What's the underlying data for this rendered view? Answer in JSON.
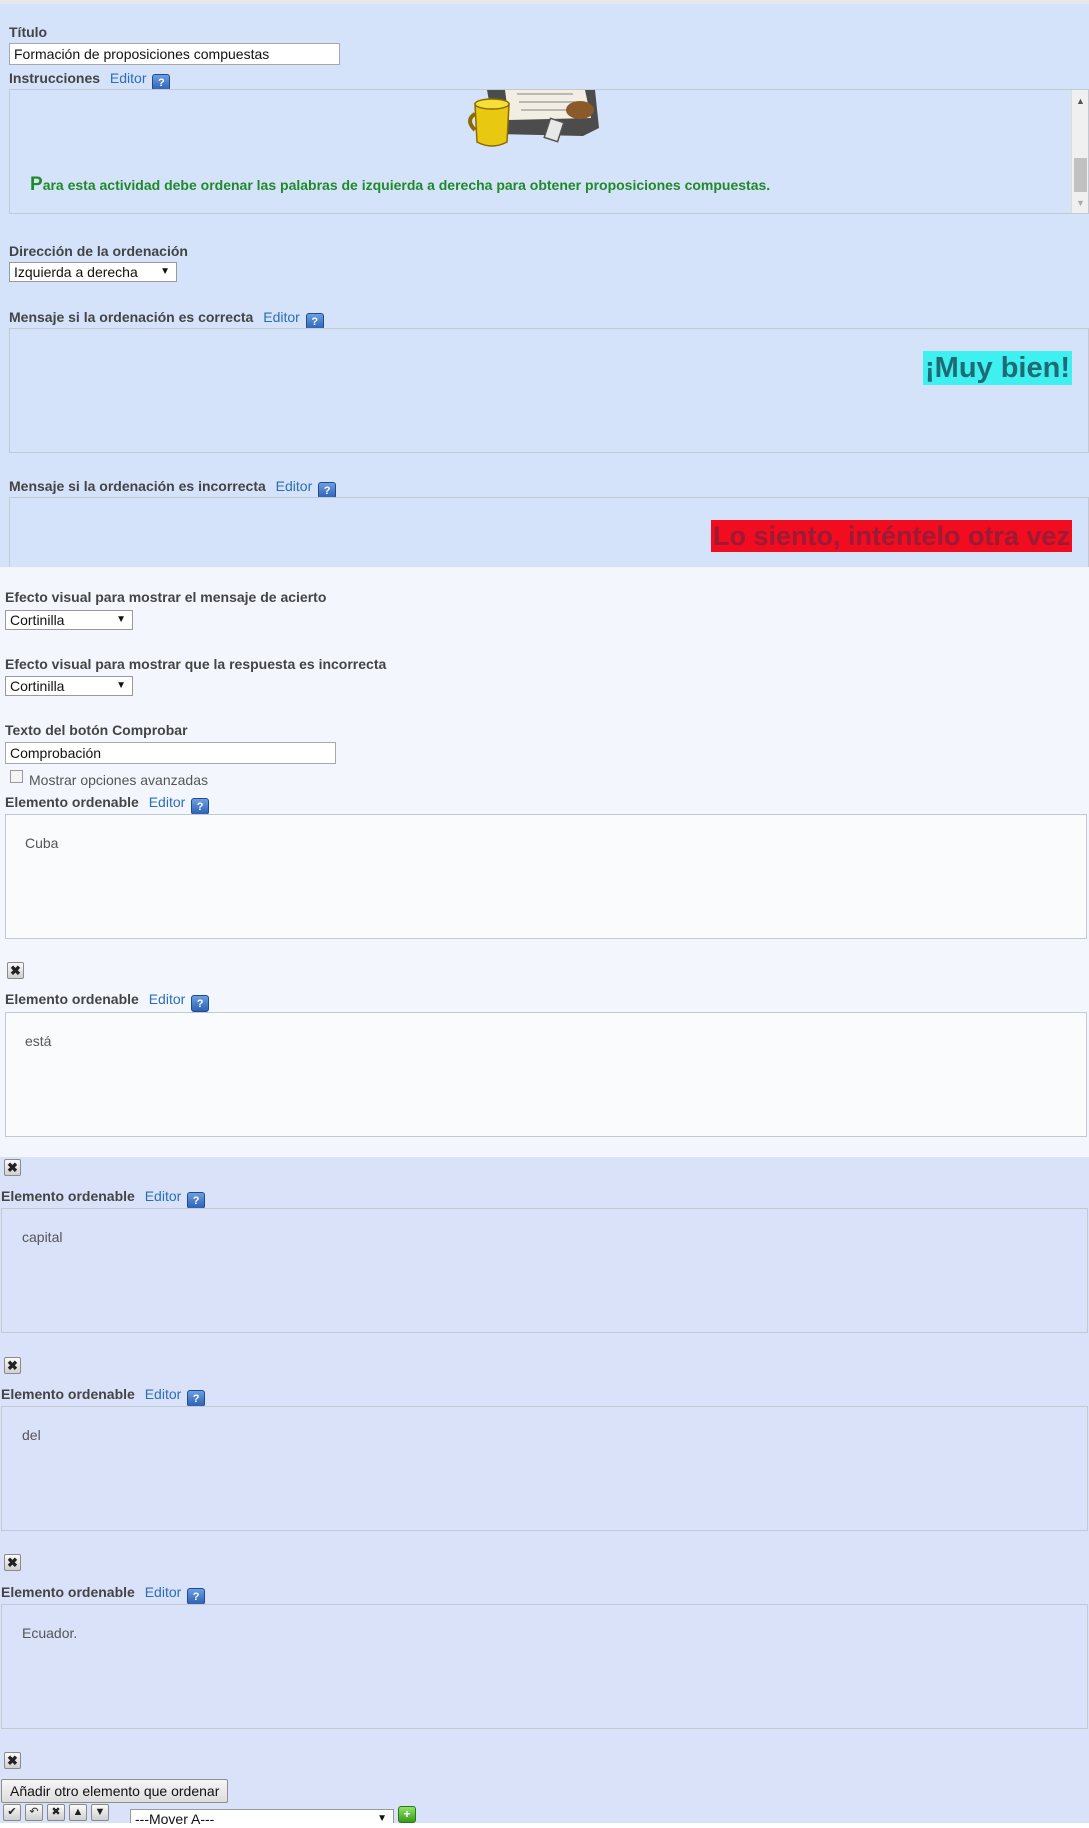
{
  "title": {
    "label": "Título",
    "value": "Formación de proposiciones compuestas"
  },
  "instructions": {
    "label": "Instrucciones",
    "editor_link": "Editor",
    "help": "?",
    "text_initial": "P",
    "text_rest": "ara esta actividad debe ordenar las palabras de izquierda a derecha para obtener  proposiciones compuestas."
  },
  "direction": {
    "label": "Dirección de la ordenación",
    "value": "Izquierda a derecha"
  },
  "correct_msg": {
    "label": "Mensaje si la ordenación es correcta",
    "editor_link": "Editor",
    "help": "?",
    "text": "¡Muy bien!"
  },
  "incorrect_msg": {
    "label": "Mensaje si la ordenación es incorrecta",
    "editor_link": "Editor",
    "help": "?",
    "text": "Lo siento, inténtelo otra vez"
  },
  "success_effect": {
    "label": "Efecto visual para mostrar el mensaje de acierto",
    "value": "Cortinilla"
  },
  "fail_effect": {
    "label": "Efecto visual para mostrar que la respuesta es incorrecta",
    "value": "Cortinilla"
  },
  "check_button_text": {
    "label": "Texto del botón Comprobar",
    "value": "Comprobación"
  },
  "advanced": {
    "label": "Mostrar opciones avanzadas"
  },
  "items": [
    {
      "label": "Elemento ordenable",
      "editor_link": "Editor",
      "help": "?",
      "value": "Cuba"
    },
    {
      "label": "Elemento ordenable",
      "editor_link": "Editor",
      "help": "?",
      "value": "está"
    },
    {
      "label": "Elemento ordenable",
      "editor_link": "Editor",
      "help": "?",
      "value": "capital"
    },
    {
      "label": "Elemento ordenable",
      "editor_link": "Editor",
      "help": "?",
      "value": "del"
    },
    {
      "label": "Elemento ordenable",
      "editor_link": "Editor",
      "help": "?",
      "value": "Ecuador."
    }
  ],
  "add_button": "Añadir otro elemento que ordenar",
  "move_select": "---Mover A---",
  "colors": {
    "success_bg": "#3ef0ef",
    "error_bg": "#f20c1f",
    "instr_text": "#1f8a2a",
    "link": "#2a6fb5"
  }
}
